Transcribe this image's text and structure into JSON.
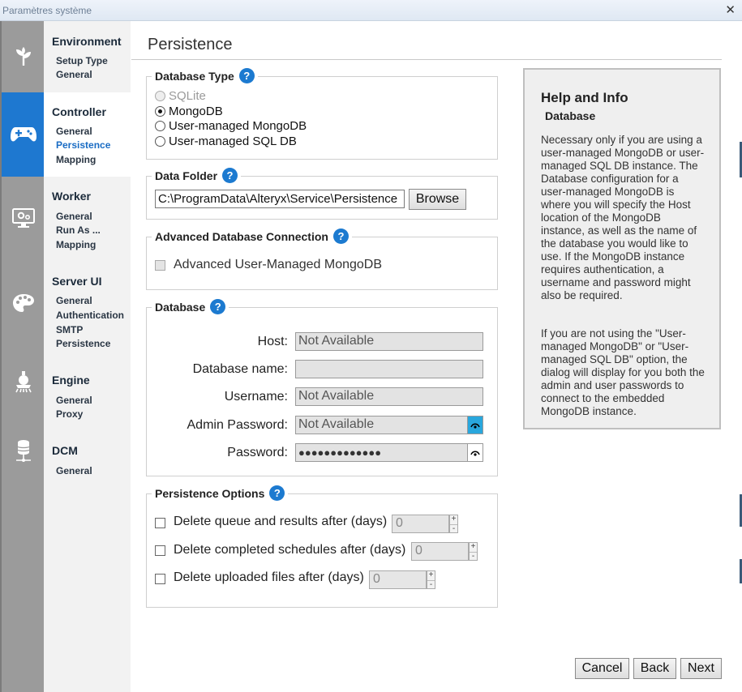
{
  "window": {
    "title": "Paramètres système",
    "close_glyph": "✕"
  },
  "nav": [
    {
      "icon": "sprout-icon",
      "heading": "Environment",
      "items": [
        "Setup Type",
        "General"
      ],
      "active": false
    },
    {
      "icon": "gamepad-icon",
      "heading": "Controller",
      "items": [
        "General",
        "Persistence",
        "Mapping"
      ],
      "active": true,
      "selected": "Persistence"
    },
    {
      "icon": "monitor-gear-icon",
      "heading": "Worker",
      "items": [
        "General",
        "Run As ...",
        "Mapping"
      ],
      "active": false
    },
    {
      "icon": "palette-icon",
      "heading": "Server UI",
      "items": [
        "General",
        "Authentication",
        "SMTP",
        "Persistence"
      ],
      "active": false
    },
    {
      "icon": "engine-icon",
      "heading": "Engine",
      "items": [
        "General",
        "Proxy"
      ],
      "active": false
    },
    {
      "icon": "database-network-icon",
      "heading": "DCM",
      "items": [
        "General"
      ],
      "active": false
    }
  ],
  "page": {
    "title": "Persistence"
  },
  "database_type": {
    "legend": "Database Type",
    "help_glyph": "?",
    "options": [
      {
        "label": "SQLite",
        "selected": false,
        "disabled": true
      },
      {
        "label": "MongoDB",
        "selected": true,
        "disabled": false
      },
      {
        "label": "User-managed MongoDB",
        "selected": false,
        "disabled": false
      },
      {
        "label": "User-managed SQL DB",
        "selected": false,
        "disabled": false
      }
    ]
  },
  "data_folder": {
    "legend": "Data Folder",
    "help_glyph": "?",
    "path": "C:\\ProgramData\\Alteryx\\Service\\Persistence",
    "browse_label": "Browse"
  },
  "advanced": {
    "legend": "Advanced Database Connection",
    "help_glyph": "?",
    "checkbox_label": "Advanced User-Managed MongoDB"
  },
  "database": {
    "legend": "Database",
    "help_glyph": "?",
    "host_label": "Host:",
    "host_value": "Not Available",
    "dbname_label": "Database name:",
    "dbname_value": "",
    "username_label": "Username:",
    "username_value": "Not Available",
    "admin_password_label": "Admin Password:",
    "admin_password_value": "Not Available",
    "password_label": "Password:",
    "password_value": "●●●●●●●●●●●●●"
  },
  "persistence_options": {
    "legend": "Persistence Options",
    "help_glyph": "?",
    "rows": [
      {
        "label": "Delete queue and results after (days)",
        "value": "0"
      },
      {
        "label": "Delete completed schedules after (days)",
        "value": "0"
      },
      {
        "label": "Delete uploaded files after (days)",
        "value": "0"
      }
    ],
    "plus": "+",
    "minus": "-"
  },
  "help": {
    "title": "Help and Info",
    "subtitle": "Database",
    "paragraph1": "Necessary only if you are using a user-managed MongoDB or user-managed SQL DB instance. The Database configuration for a user-managed MongoDB is where you will specify the Host location of the MongoDB instance, as well as the name of the database you would like to use. If the MongoDB instance requires authentication, a username and password might also be required.",
    "paragraph2": "If you are not using the \"User-managed MongoDB\" or \"User-managed SQL DB\" option, the dialog will display for you both the admin and user passwords to connect to the embedded MongoDB instance."
  },
  "footer": {
    "cancel": "Cancel",
    "back": "Back",
    "next": "Next"
  },
  "colors": {
    "accent": "#1e78d0",
    "help_badge": "#1c7ad0",
    "eye_active": "#29a7dd",
    "sidebar": "#9b9b9b"
  }
}
